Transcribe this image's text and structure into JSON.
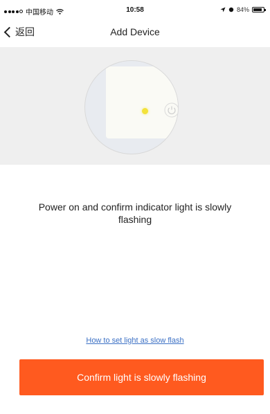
{
  "status_bar": {
    "carrier": "中国移动",
    "time": "10:58",
    "battery_text": "84%",
    "battery_level": 0.84
  },
  "nav": {
    "back_label": "返回",
    "title": "Add Device"
  },
  "illustration": {
    "icons": [
      "indicator-light",
      "power-button-icon"
    ]
  },
  "main": {
    "instruction": "Power on and confirm indicator light is slowly flashing",
    "help_link": "How to set light as slow flash",
    "confirm_button": "Confirm light is slowly flashing"
  },
  "colors": {
    "accent": "#ff5a1f",
    "link": "#3a6fc4",
    "indicator": "#f3e23a",
    "panel_bg": "#efefef"
  }
}
